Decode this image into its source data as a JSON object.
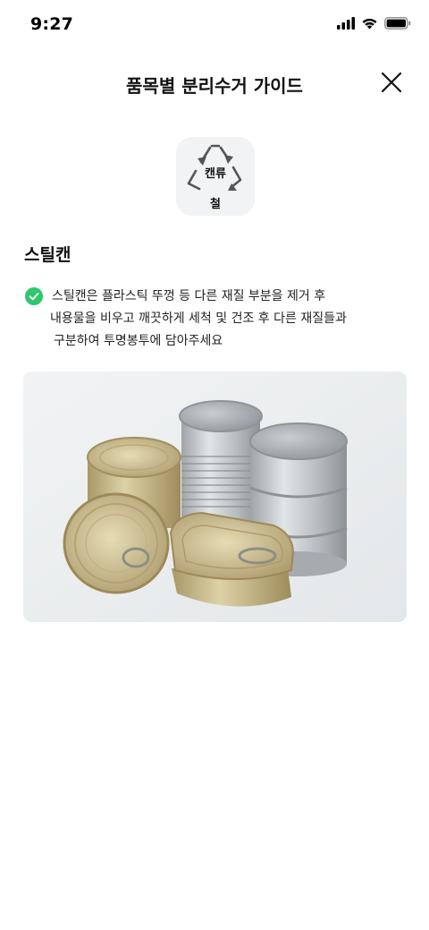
{
  "status_bar": {
    "time": "9:27",
    "icons": [
      "signal-icon",
      "wifi-icon",
      "battery-icon"
    ]
  },
  "header": {
    "title": "품목별 분리수거 가이드",
    "close_icon": "close-icon"
  },
  "badge": {
    "top_label": "캔류",
    "bottom_label": "철",
    "icon": "recycle-icon"
  },
  "item": {
    "title": "스틸캔",
    "description_lines": [
      "스틸캔은 플라스틱 뚜껑 등 다른 재질 부분을 제거 후",
      "내용물을 비우고 깨끗하게 세척 및 건조 후 다른 재질들과",
      "구분하여 투명봉투에 담아주세요"
    ]
  },
  "colors": {
    "check": "#2ec76c",
    "badge_bg": "#f2f3f5",
    "photo_bg": "#eceff1"
  }
}
